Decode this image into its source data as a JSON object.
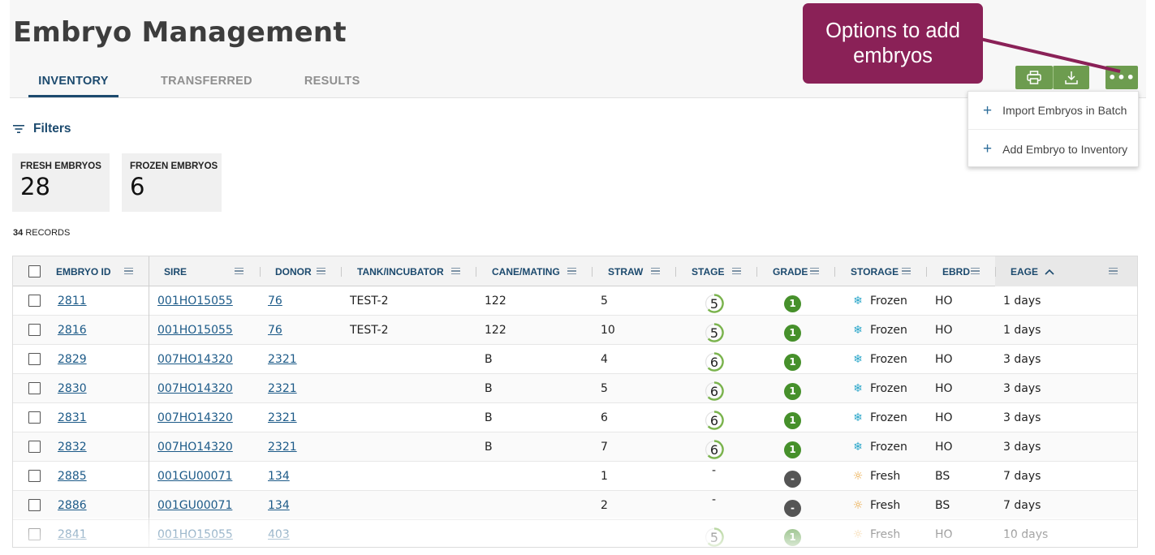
{
  "page": {
    "title": "Embryo Management"
  },
  "tabs": [
    {
      "label": "INVENTORY",
      "active": true
    },
    {
      "label": "TRANSFERRED",
      "active": false
    },
    {
      "label": "RESULTS",
      "active": false
    }
  ],
  "toolbar": {
    "print_icon": "printer-icon",
    "download_icon": "download-icon",
    "more_label": "•••"
  },
  "callout": {
    "line1": "Options to add",
    "line2": "embryos"
  },
  "menu": {
    "items": [
      {
        "label": "Import Embryos in Batch",
        "icon": "plus-icon"
      },
      {
        "label": "Add Embryo to Inventory",
        "icon": "plus-icon"
      }
    ]
  },
  "filters": {
    "label": "Filters"
  },
  "summary": [
    {
      "label": "FRESH EMBRYOS",
      "value": "28"
    },
    {
      "label": "FROZEN EMBRYOS",
      "value": "6"
    }
  ],
  "records": {
    "count": "34",
    "label": "RECORDS"
  },
  "table": {
    "columns": [
      "EMBRYO ID",
      "SIRE",
      "DONOR",
      "TANK/INCUBATOR",
      "CANE/MATING",
      "STRAW",
      "STAGE",
      "GRADE",
      "STORAGE",
      "EBRD",
      "EAGE"
    ],
    "sort": {
      "column": "EAGE",
      "direction": "asc"
    },
    "rows": [
      {
        "id": "2811",
        "sire": "001HO15055",
        "donor": "76",
        "tank": "TEST-2",
        "cane": "122",
        "straw": "5",
        "stage": "5",
        "grade": "1",
        "storage": "Frozen",
        "ebrd": "HO",
        "eage": "1 days"
      },
      {
        "id": "2816",
        "sire": "001HO15055",
        "donor": "76",
        "tank": "TEST-2",
        "cane": "122",
        "straw": "10",
        "stage": "5",
        "grade": "1",
        "storage": "Frozen",
        "ebrd": "HO",
        "eage": "1 days"
      },
      {
        "id": "2829",
        "sire": "007HO14320",
        "donor": "2321",
        "tank": "",
        "cane": "B",
        "straw": "4",
        "stage": "6",
        "grade": "1",
        "storage": "Frozen",
        "ebrd": "HO",
        "eage": "3 days"
      },
      {
        "id": "2830",
        "sire": "007HO14320",
        "donor": "2321",
        "tank": "",
        "cane": "B",
        "straw": "5",
        "stage": "6",
        "grade": "1",
        "storage": "Frozen",
        "ebrd": "HO",
        "eage": "3 days"
      },
      {
        "id": "2831",
        "sire": "007HO14320",
        "donor": "2321",
        "tank": "",
        "cane": "B",
        "straw": "6",
        "stage": "6",
        "grade": "1",
        "storage": "Frozen",
        "ebrd": "HO",
        "eage": "3 days"
      },
      {
        "id": "2832",
        "sire": "007HO14320",
        "donor": "2321",
        "tank": "",
        "cane": "B",
        "straw": "7",
        "stage": "6",
        "grade": "1",
        "storage": "Frozen",
        "ebrd": "HO",
        "eage": "3 days"
      },
      {
        "id": "2885",
        "sire": "001GU00071",
        "donor": "134",
        "tank": "",
        "cane": "",
        "straw": "1",
        "stage": "-",
        "grade": "-",
        "storage": "Fresh",
        "ebrd": "BS",
        "eage": "7 days"
      },
      {
        "id": "2886",
        "sire": "001GU00071",
        "donor": "134",
        "tank": "",
        "cane": "",
        "straw": "2",
        "stage": "-",
        "grade": "-",
        "storage": "Fresh",
        "ebrd": "BS",
        "eage": "7 days"
      },
      {
        "id": "2841",
        "sire": "001HO15055",
        "donor": "403",
        "tank": "",
        "cane": "",
        "straw": "",
        "stage": "5",
        "grade": "1",
        "storage": "Fresh",
        "ebrd": "HO",
        "eage": "10 days"
      }
    ]
  },
  "colors": {
    "primary": "#1c4a6e",
    "accent_green": "#6d9c4f",
    "grade_green": "#46902b",
    "callout": "#8a2157",
    "frozen": "#2aa6c9",
    "fresh": "#e8a33a"
  }
}
